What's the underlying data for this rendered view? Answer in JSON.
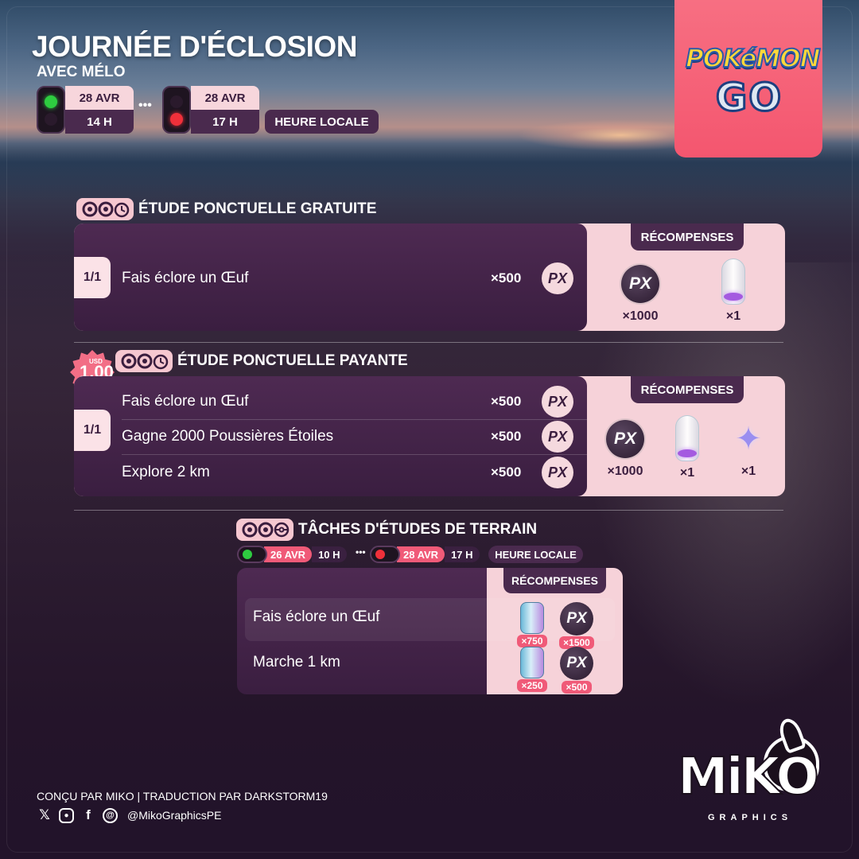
{
  "header": {
    "title": "JOURNÉE D'ÉCLOSION",
    "subtitle": "AVEC MÉLO",
    "start": {
      "date": "28 AVR",
      "hour": "14 H"
    },
    "ellipsis": "•••",
    "end": {
      "date": "28 AVR",
      "hour": "17 H"
    },
    "local_time": "HEURE LOCALE"
  },
  "logo": {
    "top": "POKéMON",
    "bottom": "GO"
  },
  "free_research": {
    "title": "ÉTUDE PONCTUELLE GRATUITE",
    "step": "1/1",
    "tasks": [
      {
        "text": "Fais éclore un Œuf",
        "qty": "×500",
        "badge": "PX"
      }
    ],
    "rewards_label": "RÉCOMPENSES",
    "rewards": [
      {
        "icon": "xp-icon",
        "label": "PX",
        "qty": "×1000"
      },
      {
        "icon": "incubator-icon",
        "qty": "×1"
      }
    ]
  },
  "paid_research": {
    "price_currency": "USD",
    "price": "1.00",
    "title": "ÉTUDE PONCTUELLE PAYANTE",
    "step": "1/1",
    "tasks": [
      {
        "text": "Fais éclore un Œuf",
        "qty": "×500",
        "badge": "PX"
      },
      {
        "text": "Gagne 2000 Poussières Étoiles",
        "qty": "×500",
        "badge": "PX"
      },
      {
        "text": "Explore 2 km",
        "qty": "×500",
        "badge": "PX"
      }
    ],
    "rewards_label": "RÉCOMPENSES",
    "rewards": [
      {
        "icon": "xp-icon",
        "label": "PX",
        "qty": "×1000"
      },
      {
        "icon": "incubator-icon",
        "qty": "×1"
      },
      {
        "icon": "star-piece-icon",
        "qty": "×1"
      }
    ]
  },
  "field_research": {
    "title": "TÂCHES D'ÉTUDES DE TERRAIN",
    "start": {
      "date": "26 AVR",
      "hour": "10 H"
    },
    "ellipsis": "•••",
    "end": {
      "date": "28 AVR",
      "hour": "17 H"
    },
    "local_time": "HEURE LOCALE",
    "rewards_label": "RÉCOMPENSES",
    "tasks": [
      {
        "text": "Fais éclore un Œuf",
        "stardust_qty": "×750",
        "xp_label": "PX",
        "xp_qty": "×1500"
      },
      {
        "text": "Marche 1 km",
        "stardust_qty": "×250",
        "xp_label": "PX",
        "xp_qty": "×500"
      }
    ]
  },
  "footer": {
    "credit": "CONÇU PAR MIKO | TRADUCTION PAR DARKSTORM19",
    "social_icons": [
      "x-icon",
      "instagram-icon",
      "facebook-icon",
      "threads-icon"
    ],
    "handle": "@MikoGraphicsPE",
    "brand": "MiKO",
    "brand_sub": "GRAPHICS"
  },
  "colors": {
    "accent_pink": "#f6d2d9",
    "panel_purple": "#4e2a52",
    "badge_red": "#f05a78",
    "logo_banner": "#f4566f",
    "light_green": "#2ecc40",
    "light_red": "#f0303a"
  }
}
